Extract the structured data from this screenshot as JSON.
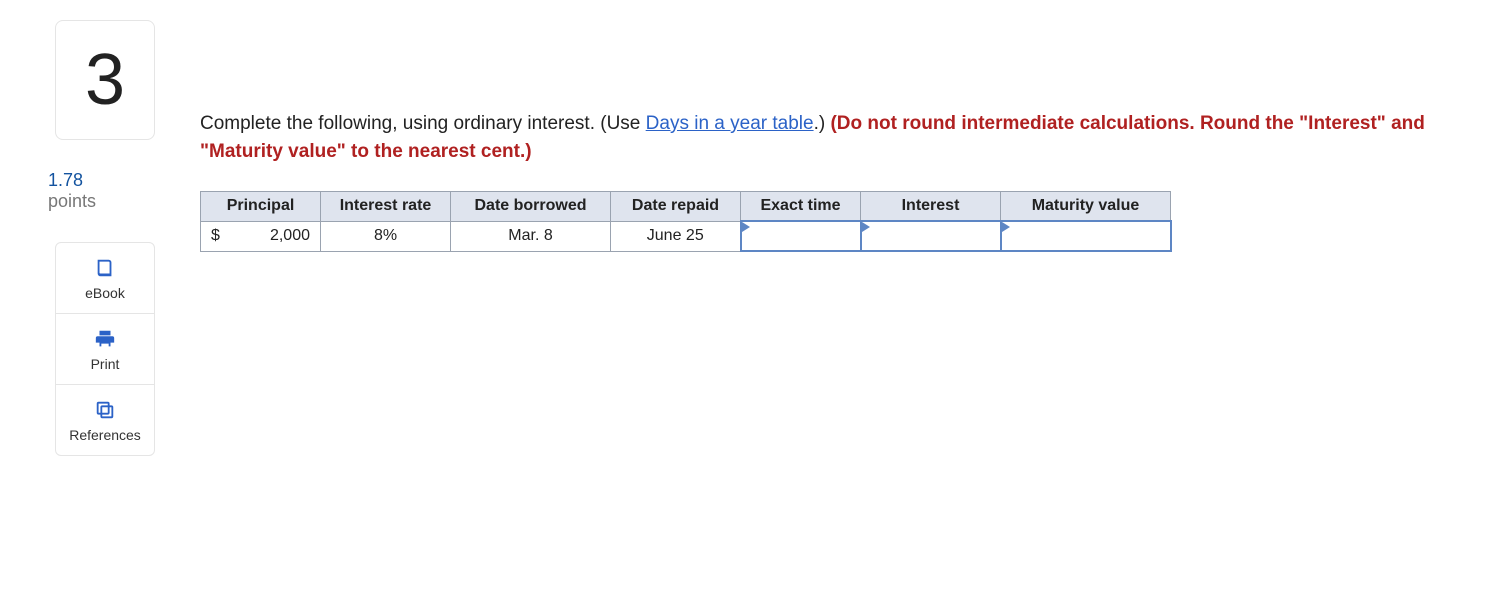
{
  "question": {
    "number": "3",
    "points_value": "1.78",
    "points_label": "points"
  },
  "tools": {
    "ebook": "eBook",
    "print": "Print",
    "references": "References"
  },
  "prompt": {
    "lead": "Complete the following, using ordinary interest. (Use ",
    "link": "Days in a year table",
    "after_link": ".) ",
    "bold": "(Do not round intermediate calculations. Round the \"Interest\" and \"Maturity value\" to the nearest cent.)"
  },
  "table": {
    "headers": {
      "principal": "Principal",
      "rate": "Interest rate",
      "borrowed": "Date borrowed",
      "repaid": "Date repaid",
      "exact": "Exact time",
      "interest": "Interest",
      "maturity": "Maturity value"
    },
    "row": {
      "currency": "$",
      "principal": "2,000",
      "rate": "8%",
      "borrowed": "Mar. 8",
      "repaid": "June 25",
      "exact": "",
      "interest": "",
      "maturity": ""
    }
  }
}
